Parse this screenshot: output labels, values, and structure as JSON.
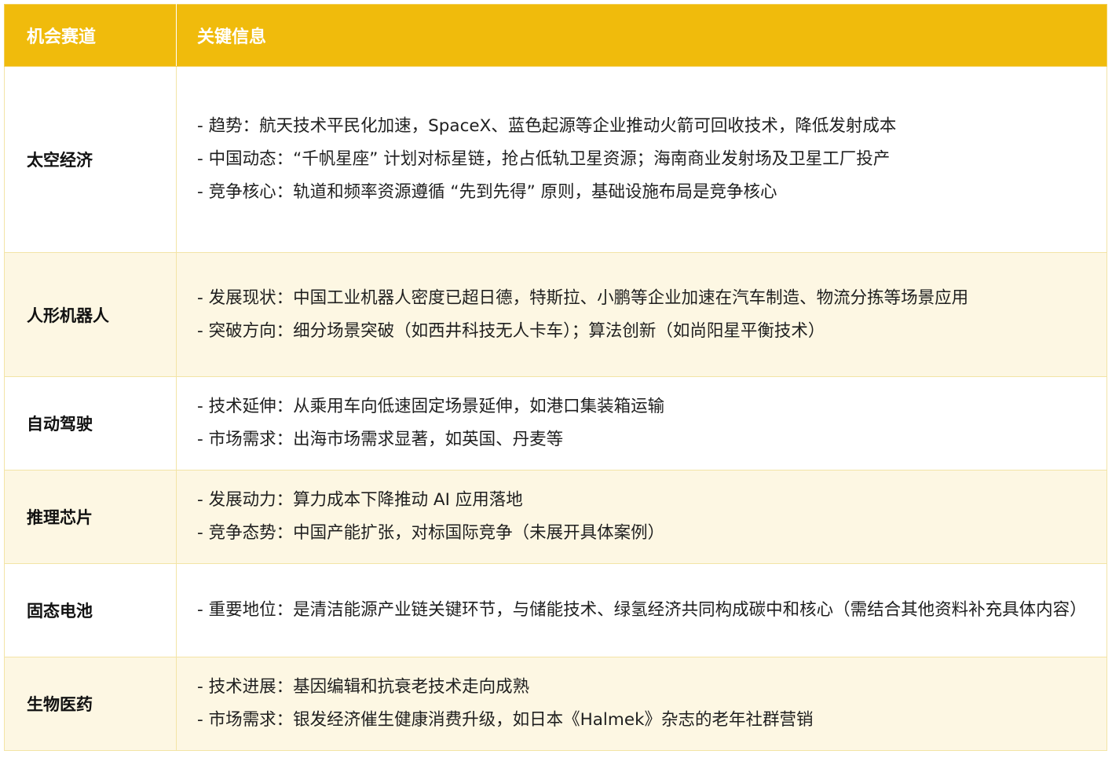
{
  "table": {
    "headers": [
      "机会赛道",
      "关键信息"
    ],
    "rows": [
      {
        "category": "太空经济",
        "lines": [
          "- 趋势：航天技术平民化加速，SpaceX、蓝色起源等企业推动火箭可回收技术，降低发射成本",
          "- 中国动态：“千帆星座” 计划对标星链，抢占低轨卫星资源；海南商业发射场及卫星工厂投产",
          "- 竞争核心：轨道和频率资源遵循 “先到先得” 原则，基础设施布局是竞争核心"
        ]
      },
      {
        "category": "人形机器人",
        "lines": [
          "- 发展现状：中国工业机器人密度已超日德，特斯拉、小鹏等企业加速在汽车制造、物流分拣等场景应用",
          "- 突破方向：细分场景突破（如西井科技无人卡车）；算法创新（如尚阳星平衡技术）"
        ]
      },
      {
        "category": "自动驾驶",
        "lines": [
          "- 技术延伸：从乘用车向低速固定场景延伸，如港口集装箱运输",
          "- 市场需求：出海市场需求显著，如英国、丹麦等"
        ]
      },
      {
        "category": "推理芯片",
        "lines": [
          "- 发展动力：算力成本下降推动 AI 应用落地",
          "- 竞争态势：中国产能扩张，对标国际竞争（未展开具体案例）"
        ]
      },
      {
        "category": "固态电池",
        "lines": [
          "- 重要地位：是清洁能源产业链关键环节，与储能技术、绿氢经济共同构成碳中和核心（需结合其他资料补充具体内容）"
        ]
      },
      {
        "category": "生物医药",
        "lines": [
          "- 技术进展：基因编辑和抗衰老技术走向成熟",
          "- 市场需求：银发经济催生健康消费升级，如日本《Halmek》杂志的老年社群营销"
        ]
      }
    ]
  },
  "colors": {
    "header_bg": "#f0bb0c",
    "header_text": "#ffffff",
    "row_alt_bg": "#fdf7e3",
    "border": "#f3e4a6"
  }
}
